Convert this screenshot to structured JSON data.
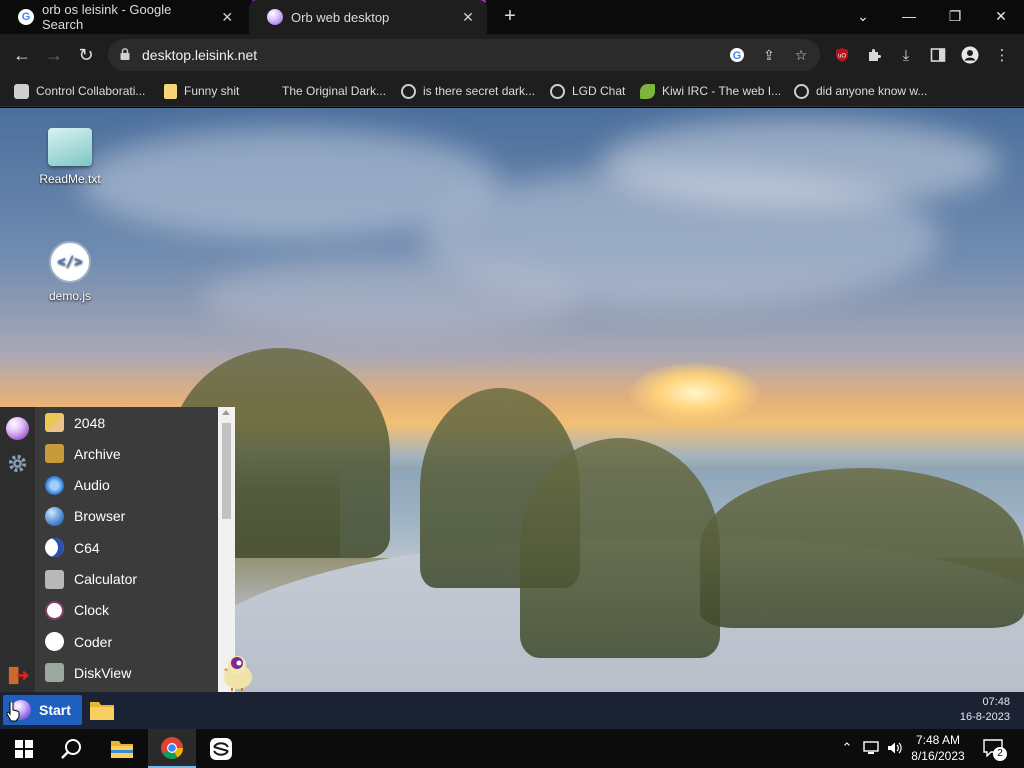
{
  "browser": {
    "tabs": [
      {
        "title": "orb os leisink - Google Search",
        "icon": "google-icon"
      },
      {
        "title": "Orb web desktop",
        "icon": "orb-icon",
        "active": true
      }
    ],
    "new_tab_glyph": "+",
    "window_controls": {
      "tab_search": "⌄",
      "minimize": "—",
      "restore": "❐",
      "close": "✕"
    },
    "url": "desktop.leisink.net",
    "nav": {
      "back": "←",
      "forward": "→",
      "reload": "↻"
    },
    "bookmarks": [
      {
        "label": "Control Collaborati...",
        "icon": "bookmark-site-icon"
      },
      {
        "label": "Funny shit",
        "icon": "folder-icon"
      },
      {
        "label": "The Original Dark...",
        "icon": "bookmark-site-icon"
      },
      {
        "label": "is there secret dark...",
        "icon": "globe-icon"
      },
      {
        "label": "LGD Chat",
        "icon": "globe-icon"
      },
      {
        "label": "Kiwi IRC - The web I...",
        "icon": "kiwi-icon"
      },
      {
        "label": "did anyone know w...",
        "icon": "globe-icon"
      }
    ],
    "accent_color": "#a72bd8"
  },
  "desktop": {
    "icons": [
      {
        "label": "ReadMe.txt",
        "icon": "text-file-icon"
      },
      {
        "label": "demo.js",
        "icon": "code-file-icon",
        "glyph": "</>"
      }
    ]
  },
  "start_menu": {
    "apps": [
      {
        "label": "2048",
        "icon": "game-2048-icon"
      },
      {
        "label": "Archive",
        "icon": "archive-icon"
      },
      {
        "label": "Audio",
        "icon": "audio-icon"
      },
      {
        "label": "Browser",
        "icon": "browser-icon"
      },
      {
        "label": "C64",
        "icon": "c64-icon"
      },
      {
        "label": "Calculator",
        "icon": "calculator-icon"
      },
      {
        "label": "Clock",
        "icon": "clock-icon"
      },
      {
        "label": "Coder",
        "icon": "coder-icon"
      },
      {
        "label": "DiskView",
        "icon": "diskview-icon"
      }
    ],
    "rail": [
      "orb-icon",
      "settings-icon",
      "logout-icon"
    ]
  },
  "orb_taskbar": {
    "start_label": "Start",
    "time": "07:48",
    "date": "16-8-2023"
  },
  "windows_taskbar": {
    "time": "7:48 AM",
    "date": "8/16/2023",
    "notification_count": "2",
    "apps": [
      "windows-start-icon",
      "search-icon",
      "file-explorer-icon",
      "chrome-icon",
      "app-icon"
    ]
  }
}
